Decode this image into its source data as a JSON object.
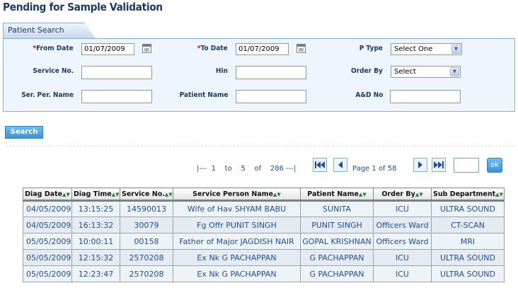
{
  "page_title": "Pending for Sample Validation",
  "search": {
    "tab_label": "Patient Search",
    "from_date": {
      "label": "From Date",
      "required_mark": "*",
      "value": "01/07/2009"
    },
    "to_date": {
      "label": "To Date",
      "required_mark": "*",
      "value": "01/07/2009"
    },
    "p_type": {
      "label": "P Type",
      "selected": "Select One"
    },
    "service_no": {
      "label": "Service No.",
      "value": ""
    },
    "hin": {
      "label": "Hin",
      "value": ""
    },
    "order_by": {
      "label": "Order By",
      "selected": "Select"
    },
    "ser_per_name": {
      "label": "Ser. Per. Name",
      "value": ""
    },
    "patient_name": {
      "label": "Patient Name",
      "value": ""
    },
    "ad_no": {
      "label": "A&D No",
      "value": ""
    },
    "search_button": "Search"
  },
  "pager": {
    "range_open": "|---",
    "from": "1",
    "to_word": "to",
    "to": "5",
    "of_word": "of",
    "total": "286",
    "range_close": "---|",
    "page_label": "Page 1 of 58",
    "goto_value": "",
    "ok_label": "ok"
  },
  "table": {
    "headers": [
      "Diag Date",
      "Diag Time",
      "Service No.",
      "Service Person Name",
      "Patient Name",
      "Order By",
      "Sub Department"
    ],
    "sort_glyph": "▲▼",
    "rows": [
      [
        "04/05/2009",
        "13:15:25",
        "14590013",
        "Wife of Hav SHYAM BABU",
        "SUNITA",
        "ICU",
        "ULTRA SOUND"
      ],
      [
        "04/05/2009",
        "16:13:32",
        "30079",
        "Fg Offr PUNIT SINGH",
        "PUNIT SINGH",
        "Officers Ward",
        "CT-SCAN"
      ],
      [
        "05/05/2009",
        "10:00:11",
        "00158",
        "Father of Major JAGDISH NAIR",
        "GOPAL KRISHNAN",
        "Officers Ward",
        "MRI"
      ],
      [
        "05/05/2009",
        "12:15:32",
        "2570208",
        "Ex Nk G PACHAPPAN",
        "G PACHAPPAN",
        "ICU",
        "ULTRA SOUND"
      ],
      [
        "05/05/2009",
        "12:23:47",
        "2570208",
        "Ex Nk G PACHAPPAN",
        "G PACHAPPAN",
        "ICU",
        "ULTRA SOUND"
      ]
    ]
  },
  "colors": {
    "title": "#1f3a66",
    "panel_bg": "#eef5fd",
    "panel_border": "#8aaed3",
    "link_text": "#1f4e9b",
    "required": "#d40000",
    "button": "#3a93da"
  },
  "icons": {
    "calendar": "calendar-icon",
    "first": "first-page-icon",
    "prev": "prev-page-icon",
    "next": "next-page-icon",
    "last": "last-page-icon",
    "dropdown": "chevron-down-icon"
  }
}
